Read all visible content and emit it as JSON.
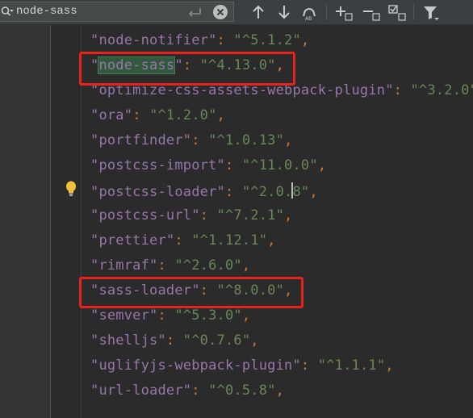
{
  "search": {
    "value": "node-sass"
  },
  "toolbar": {
    "buttons": [
      "arrow-up-icon",
      "arrow-down-icon",
      "find-all-occurrences-icon",
      "add-selection-icon",
      "remove-selection-icon",
      "select-all-icon",
      "filter-icon"
    ]
  },
  "editor": {
    "lines": [
      {
        "key": "node-notifier",
        "value": "^5.1.2"
      },
      {
        "key": "node-sass",
        "value": "^4.13.0"
      },
      {
        "key": "optimize-css-assets-webpack-plugin",
        "value": "^3.2.0"
      },
      {
        "key": "ora",
        "value": "^1.2.0"
      },
      {
        "key": "portfinder",
        "value": "^1.0.13"
      },
      {
        "key": "postcss-import",
        "value": "^11.0.0"
      },
      {
        "key": "postcss-loader",
        "value_before_caret": "^2.0.",
        "value_after_caret": "8"
      },
      {
        "key": "postcss-url",
        "value": "^7.2.1"
      },
      {
        "key": "prettier",
        "value": "^1.12.1"
      },
      {
        "key": "rimraf",
        "value": "^2.6.0"
      },
      {
        "key": "sass-loader",
        "value": "^8.0.0"
      },
      {
        "key": "semver",
        "value": "^5.3.0"
      },
      {
        "key": "shelljs",
        "value": "^0.7.6"
      },
      {
        "key": "uglifyjs-webpack-plugin",
        "value": "^1.1.1"
      },
      {
        "key": "url-loader",
        "value": "^0.5.8"
      }
    ]
  },
  "colors": {
    "background": "#2b2b2b",
    "key": "#9876aa",
    "string": "#6a8759",
    "punctuation": "#cc7832",
    "match_highlight": "#32593d",
    "annotation": "#e8231c"
  }
}
